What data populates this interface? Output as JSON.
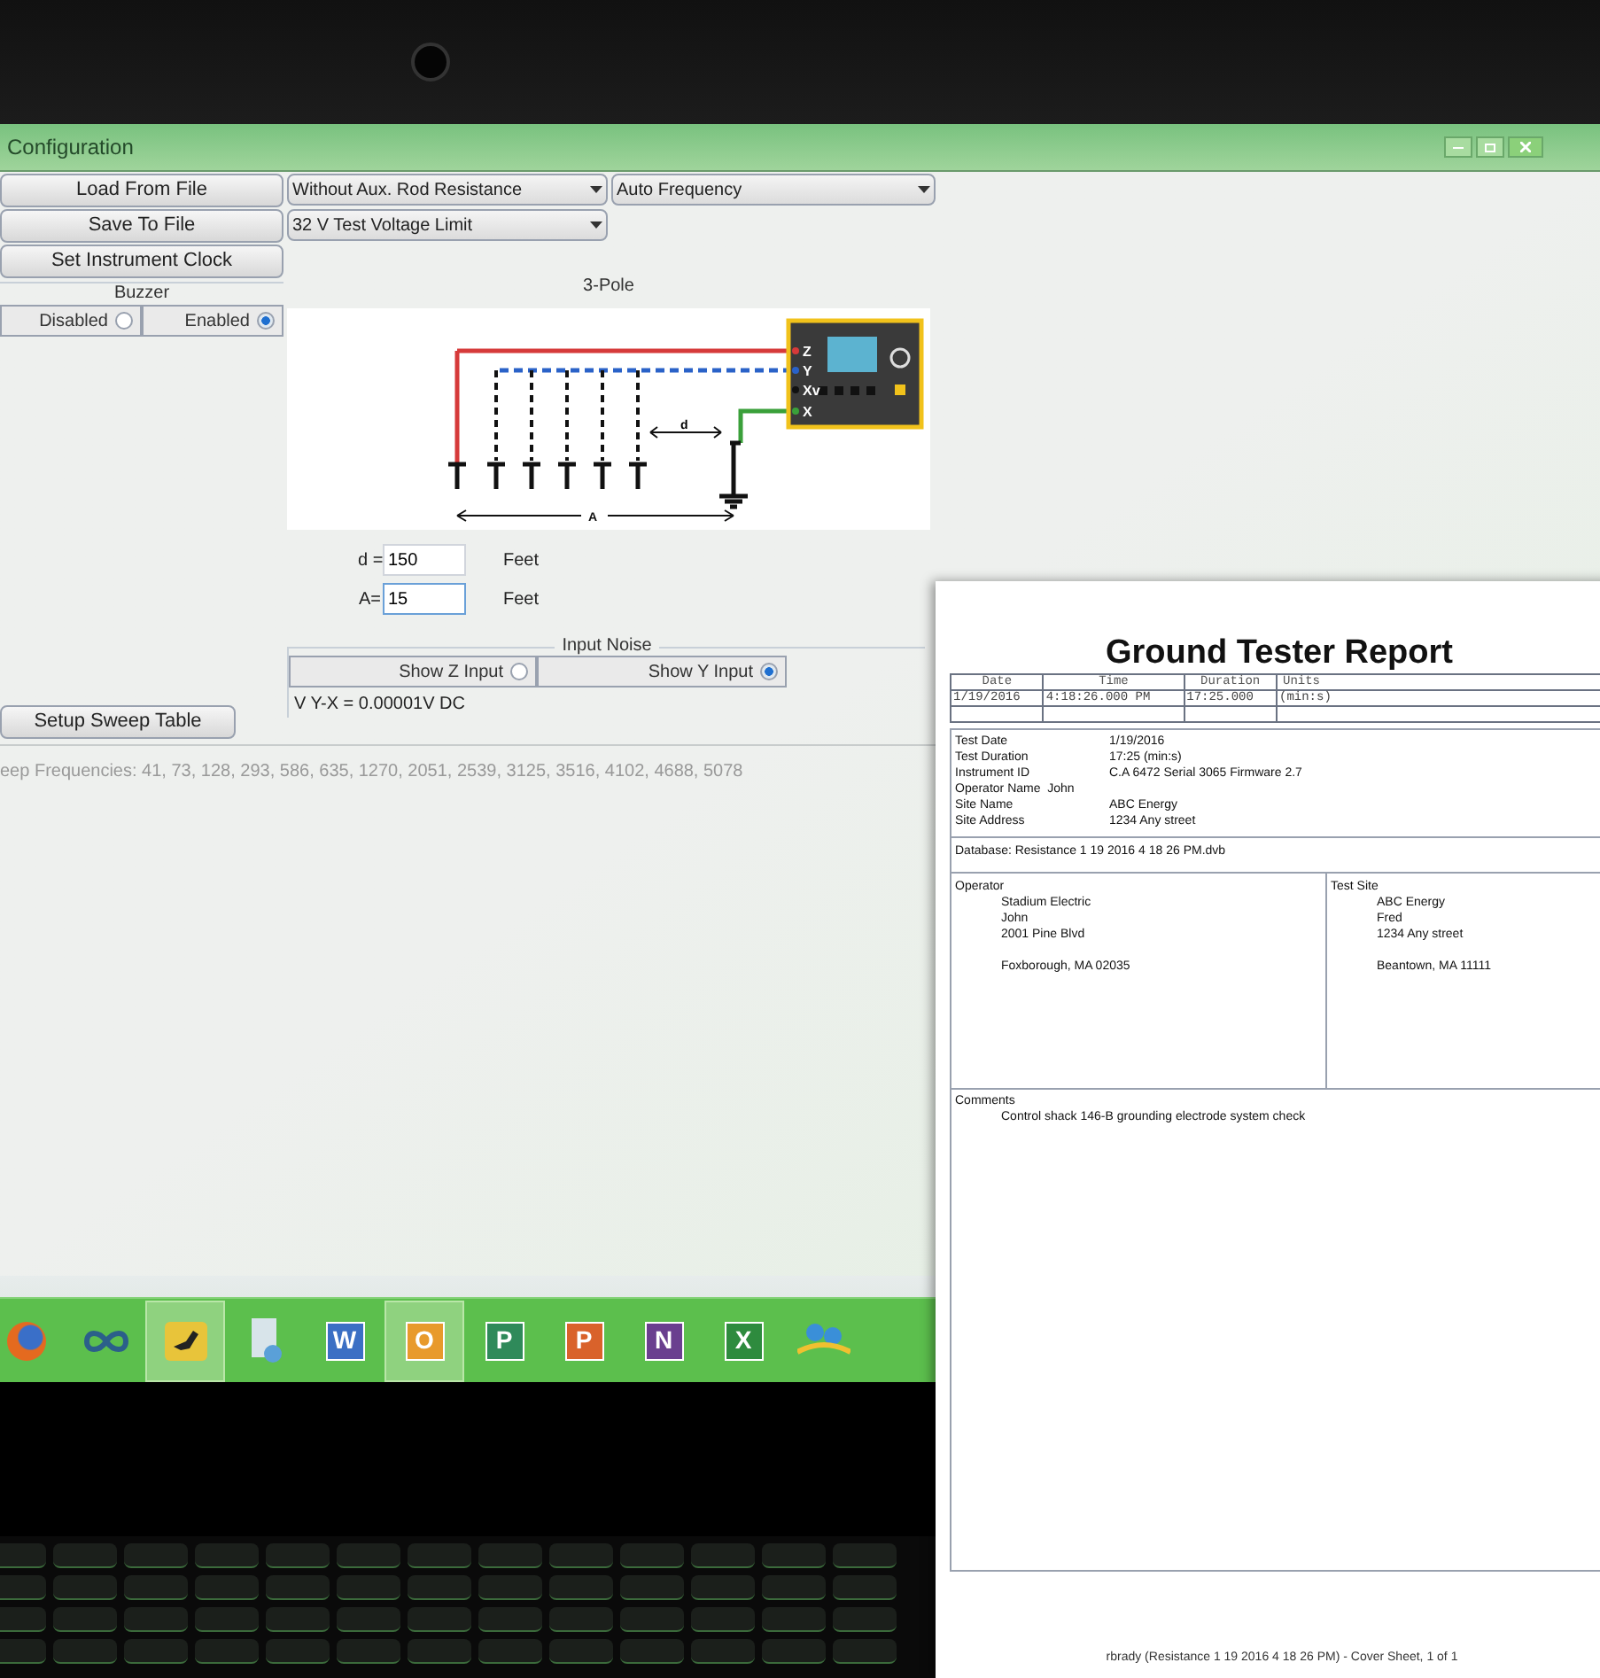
{
  "window": {
    "title": "Configuration"
  },
  "left_buttons": [
    {
      "label": "Load From File"
    },
    {
      "label": "Save To File"
    },
    {
      "label": "Set Instrument Clock"
    }
  ],
  "buzzer": {
    "title": "Buzzer",
    "options": [
      {
        "label": "Disabled",
        "selected": false
      },
      {
        "label": "Enabled",
        "selected": true
      }
    ]
  },
  "dropdowns": [
    {
      "value": "Without Aux. Rod Resistance"
    },
    {
      "value": "Auto Frequency"
    },
    {
      "value": "32 V Test Voltage Limit"
    }
  ],
  "diagram": {
    "title": "3-Pole",
    "terminals": [
      "Z",
      "Y",
      "Xv",
      "X"
    ],
    "d_label": "d",
    "a_label": "A"
  },
  "fields": [
    {
      "label": "d =",
      "value": "150",
      "unit": "Feet",
      "focused": false
    },
    {
      "label": "A=",
      "value": "15",
      "unit": "Feet",
      "focused": true
    }
  ],
  "input_noise": {
    "title": "Input Noise",
    "options": [
      {
        "label": "Show Z Input",
        "selected": false
      },
      {
        "label": "Show Y Input",
        "selected": true
      }
    ],
    "reading": "V Y-X = 0.00001V DC"
  },
  "sweep_button": {
    "label": "Setup Sweep Table"
  },
  "sweep_frequencies": "eep Frequencies: 41, 73, 128, 293, 586, 635, 1270, 2051, 2539, 3125, 3516, 4102, 4688, 5078",
  "taskbar": [
    {
      "kind": "browser",
      "active": false
    },
    {
      "kind": "infinity",
      "active": false
    },
    {
      "kind": "bird",
      "active": true
    },
    {
      "kind": "device",
      "active": false
    },
    {
      "kind": "office",
      "letter": "W",
      "color": "#3b6fc4",
      "active": false
    },
    {
      "kind": "office",
      "letter": "O",
      "color": "#e89a2c",
      "active": true
    },
    {
      "kind": "office",
      "letter": "P",
      "color": "#2f8a5a",
      "active": false
    },
    {
      "kind": "office",
      "letter": "P",
      "color": "#d9622b",
      "active": false
    },
    {
      "kind": "office",
      "letter": "N",
      "color": "#6a3f8f",
      "active": false
    },
    {
      "kind": "office",
      "letter": "X",
      "color": "#2e8b3e",
      "active": false
    },
    {
      "kind": "people",
      "active": false
    }
  ],
  "report": {
    "title": "Ground Tester Report",
    "table": {
      "columns": [
        "Date",
        "Time",
        "Duration",
        "Units"
      ],
      "row": [
        "1/19/2016",
        "4:18:26.000 PM",
        "17:25.000",
        "(min:s)"
      ]
    },
    "info": [
      {
        "label": "Test Date",
        "value": "1/19/2016"
      },
      {
        "label": "Test Duration",
        "value": "17:25 (min:s)"
      },
      {
        "label": "Instrument ID",
        "value": "C.A 6472 Serial 3065 Firmware 2.7"
      },
      {
        "label": "Operator Name  John"
      },
      {
        "label": "Site Name",
        "value": "ABC Energy"
      },
      {
        "label": "Site Address",
        "value": "1234 Any street"
      }
    ],
    "database": "Database: Resistance 1 19 2016 4 18 26 PM.dvb",
    "operator": {
      "title": "Operator",
      "paragraphs": [
        [
          "Stadium Electric",
          "John",
          "2001 Pine Blvd"
        ],
        [
          "Foxborough, MA 02035"
        ]
      ]
    },
    "test_site": {
      "title": "Test Site",
      "paragraphs": [
        [
          "ABC Energy",
          "Fred",
          "1234 Any street"
        ],
        [
          "Beantown, MA 11111"
        ]
      ]
    },
    "comments": {
      "title": "Comments",
      "text": "Control shack 146-B grounding electrode system check"
    },
    "footer": "rbrady (Resistance 1 19 2016 4 18 26 PM) - Cover Sheet, 1 of 1"
  }
}
